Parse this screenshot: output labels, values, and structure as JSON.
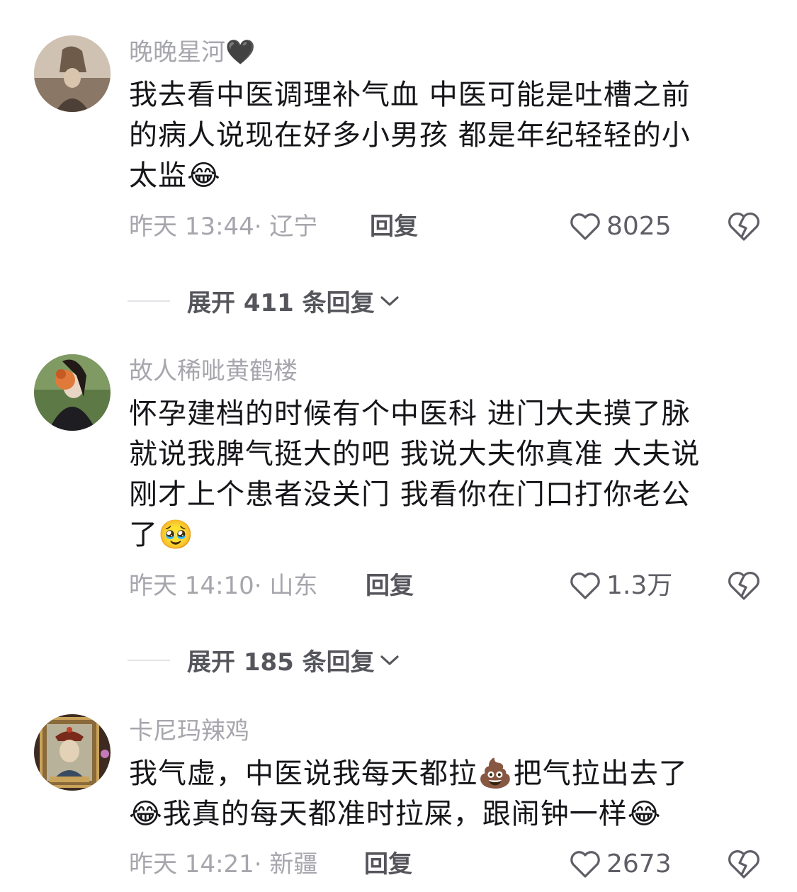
{
  "comments": [
    {
      "username": "晚晚星河",
      "badge": "🖤",
      "text_lines": [
        "我去看中医调理补气血 中医可能是吐槽之前",
        "的病人说现在好多小男孩 都是年纪轻轻的小",
        "太监"
      ],
      "trailing_emoji": "😂",
      "time": "昨天 13:44",
      "location": "辽宁",
      "reply_label": "回复",
      "likes": "8025",
      "expand_label": "展开 411 条回复"
    },
    {
      "username": "故人稀呲黄鹤楼",
      "text_lines": [
        "怀孕建档的时候有个中医科 进门大夫摸了脉",
        "就说我脾气挺大的吧 我说大夫你真准 大夫说",
        "刚才上个患者没关门 我看你在门口打你老公",
        "了"
      ],
      "trailing_emoji": "🥹",
      "time": "昨天 14:10",
      "location": "山东",
      "reply_label": "回复",
      "likes": "1.3万",
      "expand_label": "展开 185 条回复"
    },
    {
      "username": "卡尼玛辣鸡",
      "line1": "我气虚，中医说我每天都拉",
      "line1_emoji": "💩",
      "line1_after": "把气拉出去了",
      "line2_emoji": "😂",
      "line2": "我真的每天都准时拉屎，跟闹钟一样",
      "line2_end_emoji": "😂",
      "time": "昨天 14:21",
      "location": "新疆",
      "reply_label": "回复",
      "likes": "2673"
    }
  ],
  "icons": {
    "like": "heart-outline-icon",
    "dislike": "broken-heart-icon",
    "expand": "chevron-down-icon"
  },
  "colors": {
    "username": "#a6a6ad",
    "body": "#16161a",
    "meta": "#a6a6ad",
    "action": "#55555c"
  }
}
